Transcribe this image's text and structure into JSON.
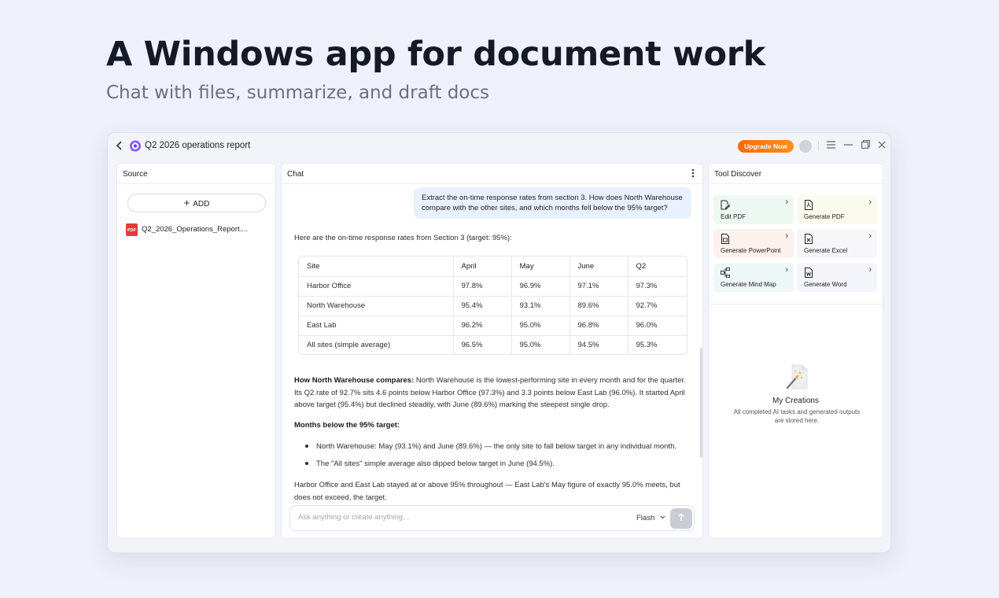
{
  "hero": {
    "title": "A Windows app for document work",
    "subtitle": "Chat with files, summarize, and draft docs"
  },
  "window": {
    "title": "Q2 2026 operations report",
    "upgrade_label": "Upgrade Now"
  },
  "source": {
    "header": "Source",
    "add_label": "ADD",
    "file_icon_label": "PDF",
    "file_name": "Q2_2026_Operations_Report...."
  },
  "chat": {
    "header": "Chat",
    "user_message": "Extract the on-time response rates from section 3. How does North Warehouse compare with the other sites, and which months fell below the 95% target?",
    "response_intro": "Here are the on-time response rates from Section 3 (target: 95%):",
    "table": {
      "headers": [
        "Site",
        "April",
        "May",
        "June",
        "Q2"
      ],
      "rows": [
        [
          "Harbor Office",
          "97.8%",
          "96.9%",
          "97.1%",
          "97.3%"
        ],
        [
          "North Warehouse",
          "95.4%",
          "93.1%",
          "89.6%",
          "92.7%"
        ],
        [
          "East Lab",
          "96.2%",
          "95.0%",
          "96.8%",
          "96.0%"
        ],
        [
          "All sites (simple average)",
          "96.5%",
          "95.0%",
          "94.5%",
          "95.3%"
        ]
      ]
    },
    "compare_heading": "How North Warehouse compares:",
    "compare_text": " North Warehouse is the lowest-performing site in every month and for the quarter. Its Q2 rate of 92.7% sits 4.6 points below Harbor Office (97.3%) and 3.3 points below East Lab (96.0%). It started April above target (95.4%) but declined steadily, with June (89.6%) marking the steepest single drop.",
    "months_heading": "Months below the 95% target:",
    "bullets": [
      "North Warehouse: May (93.1%) and June (89.6%) — the only site to fall below target in any individual month.",
      "The \"All sites\" simple average also dipped below target in June (94.5%)."
    ],
    "closing": "Harbor Office and East Lab stayed at or above 95% throughout — East Lab's May figure of exactly 95.0% meets, but does not exceed, the target.",
    "input_placeholder": "Ask anything or create anything...",
    "mode_label": "Flash"
  },
  "tools": {
    "header": "Tool Discover",
    "items": [
      {
        "label": "Edit PDF",
        "icon": "edit-pdf-icon",
        "bg": "#eef8f2"
      },
      {
        "label": "Generate PDF",
        "icon": "pdf-file-icon",
        "bg": "#fbfaef"
      },
      {
        "label": "Generate PowerPoint",
        "icon": "ppt-file-icon",
        "bg": "#fdf1ee"
      },
      {
        "label": "Generate Excel",
        "icon": "excel-file-icon",
        "bg": "#f6f6f9"
      },
      {
        "label": "Generate Mind Map",
        "icon": "mind-map-icon",
        "bg": "#eef7f8"
      },
      {
        "label": "Generate Word",
        "icon": "word-file-icon",
        "bg": "#f4f4fb"
      }
    ],
    "creations_title": "My Creations",
    "creations_desc": "All completed AI tasks and generated outputs are stored here."
  }
}
